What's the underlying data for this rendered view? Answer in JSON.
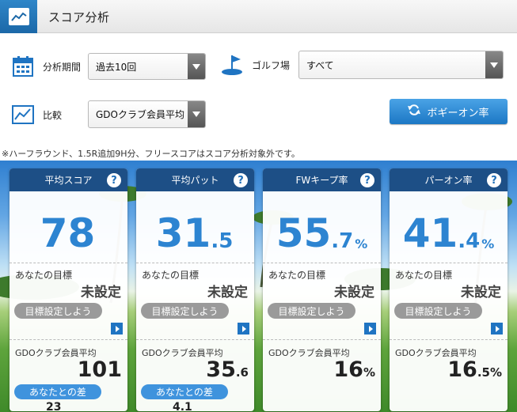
{
  "header": {
    "title": "スコア分析",
    "icon": "chart-line-icon"
  },
  "filters": {
    "period_label": "分析期間",
    "period_value": "過去10回",
    "golf_course_label": "ゴルフ場",
    "golf_course_value": "すべて",
    "compare_label": "比較",
    "compare_value": "GDOクラブ会員平均",
    "bogey_button": "ボギーオン率"
  },
  "note": "※ハーフラウンド、1.5R追加9H分、フリースコアはスコア分析対象外です。",
  "cards": [
    {
      "title": "平均スコア",
      "value_int": "78",
      "value_dec": "",
      "unit": "",
      "goal_label": "あなたの目標",
      "goal_value": "未設定",
      "goal_button": "目標設定しよう",
      "avg_label": "GDOクラブ会員平均",
      "avg_int": "101",
      "avg_dec": "",
      "avg_unit": "",
      "diff_label": "あなたとの差",
      "diff_value": "23"
    },
    {
      "title": "平均パット",
      "value_int": "31",
      "value_dec": ".5",
      "unit": "",
      "goal_label": "あなたの目標",
      "goal_value": "未設定",
      "goal_button": "目標設定しよう",
      "avg_label": "GDOクラブ会員平均",
      "avg_int": "35",
      "avg_dec": ".6",
      "avg_unit": "",
      "diff_label": "あなたとの差",
      "diff_value": "4.1"
    },
    {
      "title": "FWキープ率",
      "value_int": "55",
      "value_dec": ".7",
      "unit": "%",
      "goal_label": "あなたの目標",
      "goal_value": "未設定",
      "goal_button": "目標設定しよう",
      "avg_label": "GDOクラブ会員平均",
      "avg_int": "16",
      "avg_dec": "",
      "avg_unit": "%",
      "diff_label": "",
      "diff_value": ""
    },
    {
      "title": "パーオン率",
      "value_int": "41",
      "value_dec": ".4",
      "unit": "%",
      "goal_label": "あなたの目標",
      "goal_value": "未設定",
      "goal_button": "目標設定しよう",
      "avg_label": "GDOクラブ会員平均",
      "avg_int": "16",
      "avg_dec": ".5",
      "avg_unit": "%",
      "diff_label": "",
      "diff_value": ""
    }
  ],
  "colors": {
    "accent": "#2d84d1",
    "card_header": "#1d4f86",
    "header_icon": "#1b68a8"
  }
}
